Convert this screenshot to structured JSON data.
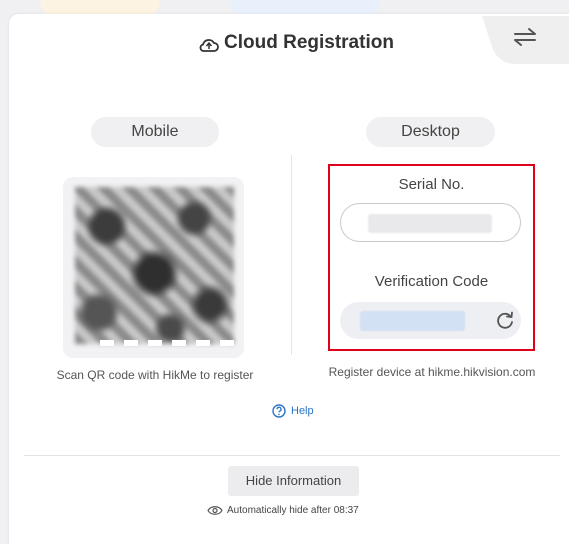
{
  "colors": {
    "accent": "#2a74c9",
    "highlight": "#e0001b",
    "panel_bg": "#ffffff",
    "tag_bg": "#f0f0f2"
  },
  "header": {
    "title": "Cloud Registration",
    "icon": "cloud-icon",
    "switch_icon": "swap-arrows-icon"
  },
  "mobile": {
    "label": "Mobile",
    "caption": "Scan QR code with HikMe to register",
    "qr_icon": "qr-code"
  },
  "desktop": {
    "label": "Desktop",
    "serial_label": "Serial No.",
    "verify_label": "Verification Code",
    "refresh_icon": "refresh-icon",
    "caption": "Register device at hikme.hikvision.com"
  },
  "help": {
    "label": "Help",
    "icon": "help-circle-icon"
  },
  "footer": {
    "hide_button": "Hide Information",
    "auto_hide": "Automatically hide after 08:37",
    "eye_icon": "eye-icon"
  }
}
